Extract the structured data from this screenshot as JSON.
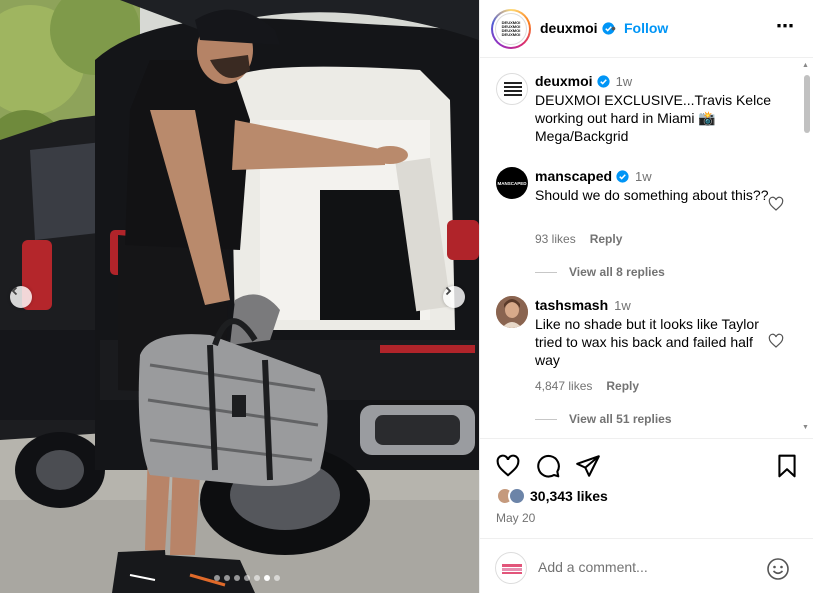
{
  "header": {
    "username": "deuxmoi",
    "separator": "•",
    "follow_label": "Follow",
    "more_label": "⋯",
    "logo_lines": [
      "DEUXMOI",
      "DEUXMOI",
      "DEUXMOI",
      "DEUXMOI"
    ]
  },
  "caption": {
    "username": "deuxmoi",
    "time": "1w",
    "text": "DEUXMOI EXCLUSIVE...Travis Kelce working out hard in Miami 📸 Mega/Backgrid"
  },
  "comments": [
    {
      "username": "manscaped",
      "verified": true,
      "time": "1w",
      "text": "Should we do something about this??",
      "likes": "93 likes",
      "reply_label": "Reply",
      "view_replies": "View all 8 replies",
      "avatar_text": "MANSCAPED"
    },
    {
      "username": "tashsmash",
      "verified": false,
      "time": "1w",
      "text": "Like no shade but it looks like Taylor tried to wax his back and failed half way",
      "likes": "4,847 likes",
      "reply_label": "Reply",
      "view_replies": "View all 51 replies"
    }
  ],
  "actions": {
    "icons": [
      "heart-icon",
      "comment-icon",
      "share-icon",
      "bookmark-icon"
    ],
    "likes": "30,343 likes",
    "date": "May 20"
  },
  "add_comment": {
    "placeholder": "Add a comment...",
    "emoji_icon": "smiley-icon"
  },
  "carousel": {
    "total_slides": 7,
    "active_slide": 6
  },
  "colors": {
    "accent": "#0095f6",
    "verified": "#0095f6",
    "muted": "#737373"
  }
}
